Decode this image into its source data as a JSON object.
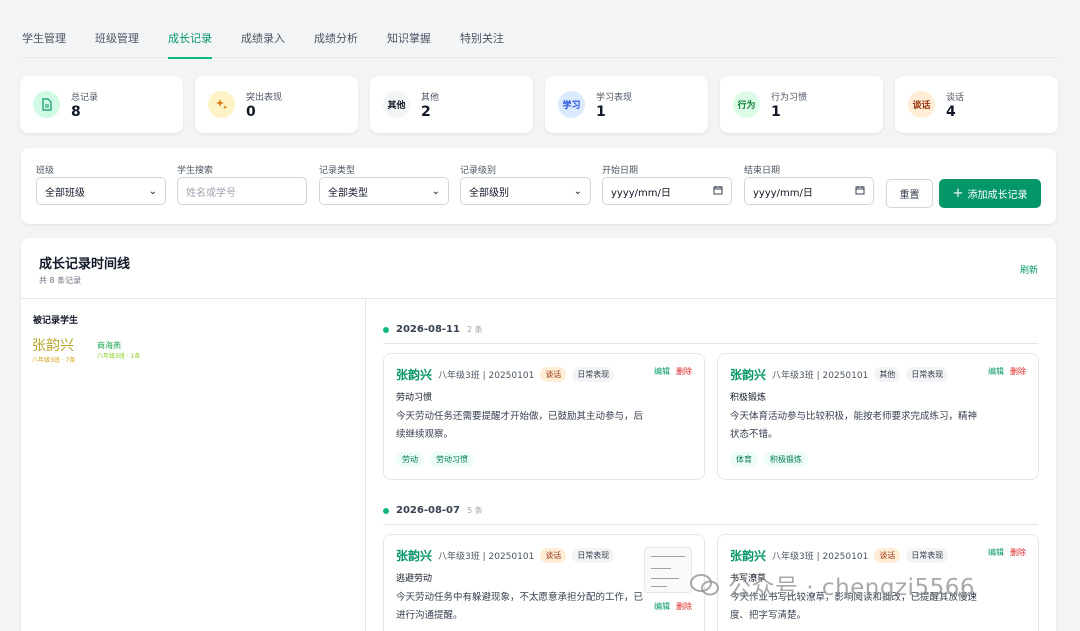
{
  "tabs": [
    "学生管理",
    "班级管理",
    "成长记录",
    "成绩录入",
    "成绩分析",
    "知识掌握",
    "特别关注"
  ],
  "stats": [
    {
      "label": "总记录",
      "value": "8",
      "icon": "document-icon",
      "bg": "#d1fae5",
      "fg": "#059669",
      "glyph": ""
    },
    {
      "label": "突出表现",
      "value": "0",
      "icon": "sparkle-icon",
      "bg": "#fef3c7",
      "fg": "#d97706",
      "glyph": ""
    },
    {
      "label": "其他",
      "value": "2",
      "icon": "other-badge",
      "bg": "#f3f4f6",
      "fg": "#111827",
      "glyph": "其他"
    },
    {
      "label": "学习表现",
      "value": "1",
      "icon": "study-badge",
      "bg": "#dbeafe",
      "fg": "#1d4ed8",
      "glyph": "学习"
    },
    {
      "label": "行为习惯",
      "value": "1",
      "icon": "behavior-badge",
      "bg": "#dcfce7",
      "fg": "#15803d",
      "glyph": "行为"
    },
    {
      "label": "谈话",
      "value": "4",
      "icon": "talk-badge",
      "bg": "#ffedd5",
      "fg": "#9a3412",
      "glyph": "谈话"
    }
  ],
  "filters": {
    "class_label": "班级",
    "class_value": "全部班级",
    "search_label": "学生搜索",
    "search_placeholder": "姓名或学号",
    "type_label": "记录类型",
    "type_value": "全部类型",
    "level_label": "记录级别",
    "level_value": "全部级别",
    "start_label": "开始日期",
    "start_placeholder": "yyyy/mm/日",
    "end_label": "结束日期",
    "end_placeholder": "yyyy/mm/日",
    "reset": "重置",
    "add": "添加成长记录"
  },
  "timeline": {
    "title": "成长记录时间线",
    "subtitle": "共 8 条记录",
    "refresh": "刷新",
    "students_title": "被记录学生",
    "students": [
      {
        "name": "张韵兴",
        "meta": "八年级3班 · 7条"
      },
      {
        "name": "商海燕",
        "meta": "八年级3班 · 1条"
      }
    ],
    "groups": [
      {
        "date": "2026-08-11",
        "count": "2 条"
      },
      {
        "date": "2026-08-07",
        "count": "5 条"
      }
    ],
    "cards": [
      {
        "name": "张韵兴",
        "meta": "八年级3班 | 20250101",
        "type": "谈话",
        "level": "日常表现",
        "title": "劳动习惯",
        "body": "今天劳动任务还需要提醒才开始做，已鼓励其主动参与，后续继续观察。",
        "tags": [
          "劳动",
          "劳动习惯"
        ],
        "edit": "编辑",
        "delete": "删除"
      },
      {
        "name": "张韵兴",
        "meta": "八年级3班 | 20250101",
        "type": "其他",
        "level": "日常表现",
        "title": "积极锻炼",
        "body": "今天体育活动参与比较积极，能按老师要求完成练习，精神状态不错。",
        "tags": [
          "体育",
          "积极锻炼"
        ],
        "edit": "编辑",
        "delete": "删除"
      },
      {
        "name": "张韵兴",
        "meta": "八年级3班 | 20250101",
        "type": "谈话",
        "level": "日常表现",
        "title": "逃避劳动",
        "body": "今天劳动任务中有躲避现象，不太愿意承担分配的工作，已进行沟通提醒。",
        "tags": [],
        "edit": "编辑",
        "delete": "删除"
      },
      {
        "name": "张韵兴",
        "meta": "八年级3班 | 20250101",
        "type": "谈话",
        "level": "日常表现",
        "title": "书写潦草",
        "body": "今天作业书写比较潦草，影响阅读和批改，已提醒其放慢速度、把字写清楚。",
        "tags": [],
        "edit": "编辑",
        "delete": "删除"
      }
    ]
  },
  "watermark": "公众号 · chengzi5566"
}
